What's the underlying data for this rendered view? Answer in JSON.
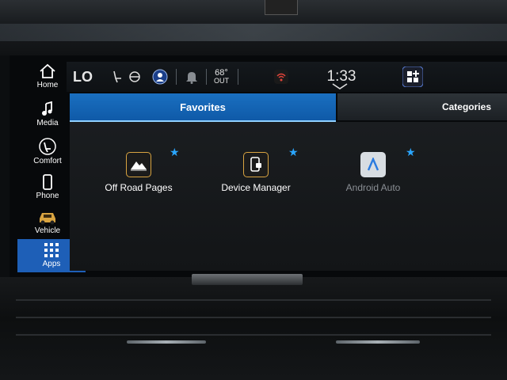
{
  "status_bar": {
    "climate_mode": "LO",
    "temperature": "68°",
    "temperature_label": "OUT",
    "clock": "1:33"
  },
  "sidebar": {
    "items": [
      {
        "label": "Home",
        "icon": "home-icon"
      },
      {
        "label": "Media",
        "icon": "music-note-icon"
      },
      {
        "label": "Comfort",
        "icon": "seat-comfort-icon"
      },
      {
        "label": "Phone",
        "icon": "phone-icon"
      },
      {
        "label": "Vehicle",
        "icon": "vehicle-icon"
      },
      {
        "label": "Apps",
        "icon": "apps-grid-icon"
      }
    ],
    "active": "Apps"
  },
  "tabs": [
    {
      "label": "Favorites",
      "active": true
    },
    {
      "label": "Categories",
      "active": false
    }
  ],
  "apps": [
    {
      "label": "Off Road Pages",
      "icon": "mountain-icon",
      "favorite": true,
      "enabled": true
    },
    {
      "label": "Device Manager",
      "icon": "device-manager-icon",
      "favorite": true,
      "enabled": true
    },
    {
      "label": "Android Auto",
      "icon": "android-auto-icon",
      "favorite": true,
      "enabled": false
    }
  ],
  "colors": {
    "accent": "#1e5fb7",
    "star": "#2aa6ff",
    "icon_border": "#d9a441"
  }
}
